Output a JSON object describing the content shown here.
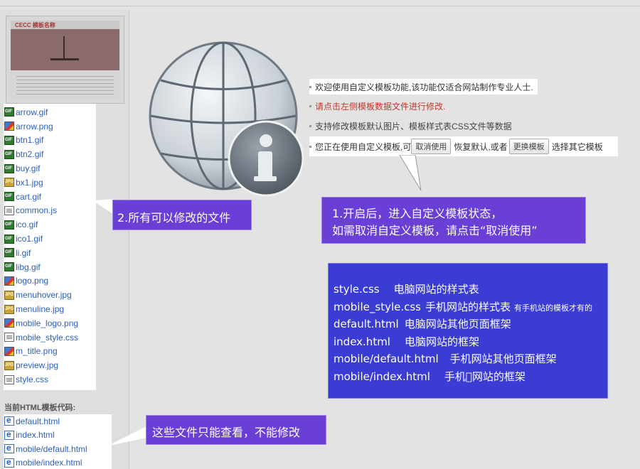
{
  "files": [
    {
      "name": "arrow.gif",
      "icon": "gif-file-icon"
    },
    {
      "name": "arrow.png",
      "icon": "png-file-icon"
    },
    {
      "name": "btn1.gif",
      "icon": "gif-file-icon"
    },
    {
      "name": "btn2.gif",
      "icon": "gif-file-icon"
    },
    {
      "name": "buy.gif",
      "icon": "gif-file-icon"
    },
    {
      "name": "bx1.jpg",
      "icon": "jpg-file-icon"
    },
    {
      "name": "cart.gif",
      "icon": "gif-file-icon"
    },
    {
      "name": "common.js",
      "icon": "js-file-icon"
    },
    {
      "name": "ico.gif",
      "icon": "gif-file-icon"
    },
    {
      "name": "ico1.gif",
      "icon": "gif-file-icon"
    },
    {
      "name": "li.gif",
      "icon": "gif-file-icon"
    },
    {
      "name": "libg.gif",
      "icon": "gif-file-icon"
    },
    {
      "name": "logo.png",
      "icon": "png-file-icon"
    },
    {
      "name": "menuhover.jpg",
      "icon": "jpg-file-icon"
    },
    {
      "name": "menuline.jpg",
      "icon": "jpg-file-icon"
    },
    {
      "name": "mobile_logo.png",
      "icon": "png-file-icon"
    },
    {
      "name": "mobile_style.css",
      "icon": "css-file-icon"
    },
    {
      "name": "m_title.png",
      "icon": "png-file-icon"
    },
    {
      "name": "preview.jpg",
      "icon": "jpg-file-icon"
    },
    {
      "name": "style.css",
      "icon": "css-file-icon"
    }
  ],
  "code_heading": "当前HTML模板代码:",
  "code_files": [
    {
      "name": "default.html",
      "icon": "html-file-icon"
    },
    {
      "name": "index.html",
      "icon": "html-file-icon"
    },
    {
      "name": "mobile/default.html",
      "icon": "html-file-icon"
    },
    {
      "name": "mobile/index.html",
      "icon": "html-file-icon"
    }
  ],
  "thumb": {
    "logo": "CECC 模板名称"
  },
  "info": {
    "line1": "欢迎使用自定义模板功能,该功能仅适合网站制作专业人士.",
    "line2": "请点击左侧模板数据文件进行修改.",
    "line3": "支持修改模板默认图片、模板样式表CSS文件等数据",
    "line4_prefix": "您正在使用自定义模板,可",
    "cancel_button": "取消使用",
    "line4_middle": "恢复默认,或者",
    "change_button": "更换模板",
    "line4_suffix": "选择其它模板"
  },
  "callouts": {
    "box1_line1": "1.开启后，进入自定义模板状态，",
    "box1_line2": "如需取消自定义模板，请点击“取消使用”",
    "box2": "2.所有可以修改的文件",
    "box3": "这些文件只能查看，不能修改",
    "box4": [
      {
        "file": "style.css",
        "desc": "电脑网站的样式表",
        "note": ""
      },
      {
        "file": "mobile_style.css",
        "desc": "手机网站的样式表",
        "note": "有手机站的模板才有的"
      },
      {
        "file": "default.html",
        "desc": "电脑网站其他页面框架",
        "note": ""
      },
      {
        "file": "index.html",
        "desc": "电脑网站的框架",
        "note": ""
      },
      {
        "file": "mobile/default.html",
        "desc": "手机网站其他页面框架",
        "note": ""
      },
      {
        "file": "mobile/index.html",
        "desc": "手机\u0000网站的框架",
        "note": ""
      }
    ]
  },
  "colors": {
    "callout_purple": "#6a3fd6",
    "callout_blue": "#3a3cd4",
    "link_blue": "#2b5fbd",
    "warning_red": "#c0392b"
  }
}
